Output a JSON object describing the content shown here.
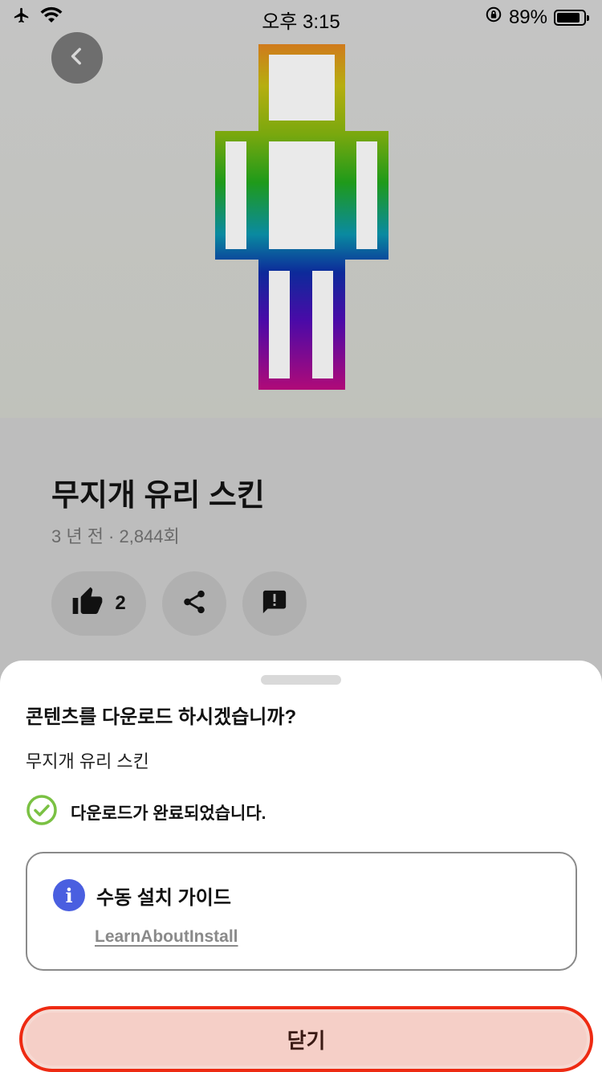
{
  "status_bar": {
    "time": "오후 3:15",
    "battery_percent": "89%",
    "icons": [
      "airplane-icon",
      "wifi-icon",
      "orientation-lock-icon",
      "battery-icon"
    ]
  },
  "header": {
    "back_icon": "chevron-left-icon"
  },
  "content": {
    "title": "무지개 유리 스킨",
    "meta": "3 년 전 · 2,844회",
    "like_count": "2",
    "action_icons": [
      "thumbs-up-icon",
      "share-icon",
      "report-icon"
    ]
  },
  "sheet": {
    "question": "콘텐츠를 다운로드 하시겠습니까?",
    "item_name": "무지개 유리 스킨",
    "status_text": "다운로드가 완료되었습니다.",
    "guide": {
      "title": "수동 설치 가이드",
      "link": "LearnAboutInstall"
    },
    "close_label": "닫기"
  },
  "colors": {
    "accent_red": "#ee2a12",
    "info_blue": "#4a5fe0",
    "success_green": "#7ac143"
  }
}
